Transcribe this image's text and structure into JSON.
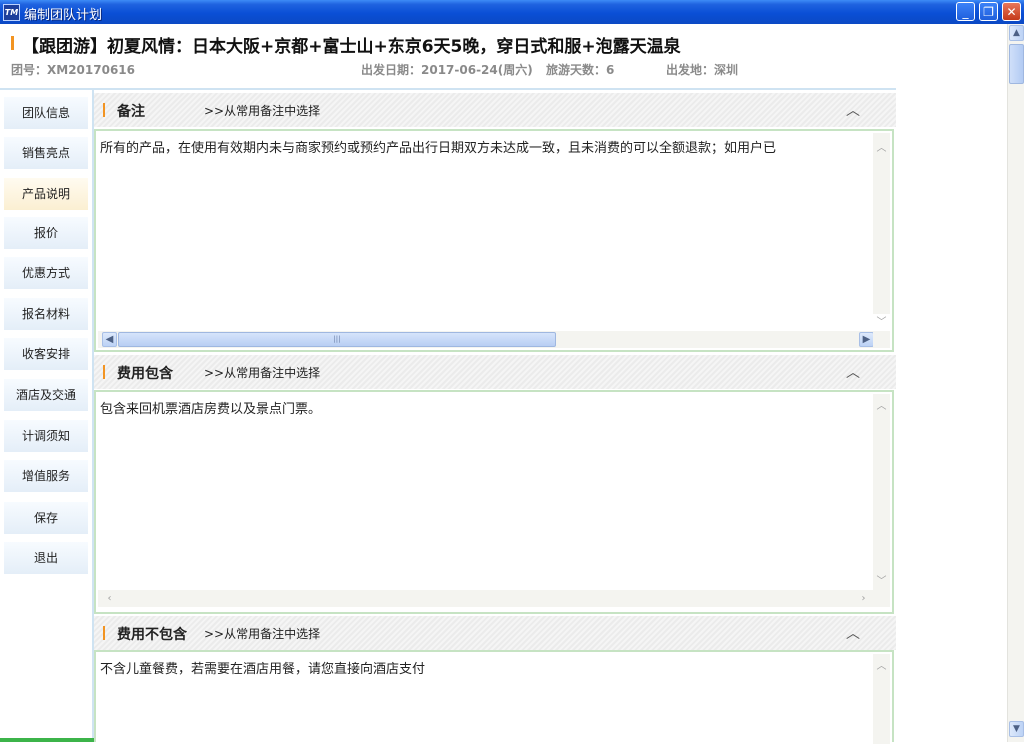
{
  "window": {
    "title": "编制团队计划",
    "icon": "app-logo-icon",
    "controls": {
      "minimize": "_",
      "restore": "❐",
      "close": "✕"
    }
  },
  "header": {
    "title": "【跟团游】初夏风情：日本大阪+京都+富士山+东京6天5晚，穿日式和服+泡露天温泉",
    "group_no": "团号：XM20170616",
    "departure_date": "出发日期：2017-06-24(周六)",
    "days": "旅游天数：6",
    "departure_place": "出发地：深圳"
  },
  "sidebar": {
    "active_index": 2,
    "items": [
      {
        "label": "团队信息"
      },
      {
        "label": "销售亮点"
      },
      {
        "label": "产品说明"
      },
      {
        "label": "报价"
      },
      {
        "label": "优惠方式"
      },
      {
        "label": "报名材料"
      },
      {
        "label": "收客安排"
      },
      {
        "label": "酒店及交通"
      },
      {
        "label": "计调须知"
      },
      {
        "label": "增值服务"
      },
      {
        "label": "保存"
      },
      {
        "label": "退出"
      }
    ]
  },
  "sections": [
    {
      "title": "备注",
      "link": ">>从常用备注中选择",
      "content": "所有的产品，在使用有效期内未与商家预约或预约产品出行日期双方未达成一致，且未消费的可以全额退款；如用户已"
    },
    {
      "title": "费用包含",
      "link": ">>从常用备注中选择",
      "content": "包含来回机票酒店房费以及景点门票。"
    },
    {
      "title": "费用不包含",
      "link": ">>从常用备注中选择",
      "content": "不含儿童餐费，若需要在酒店用餐，请您直接向酒店支付"
    }
  ],
  "colors": {
    "accent": "#f29422",
    "textbox_border": "#c6e3c3",
    "titlebar": "#0a4fd6"
  }
}
